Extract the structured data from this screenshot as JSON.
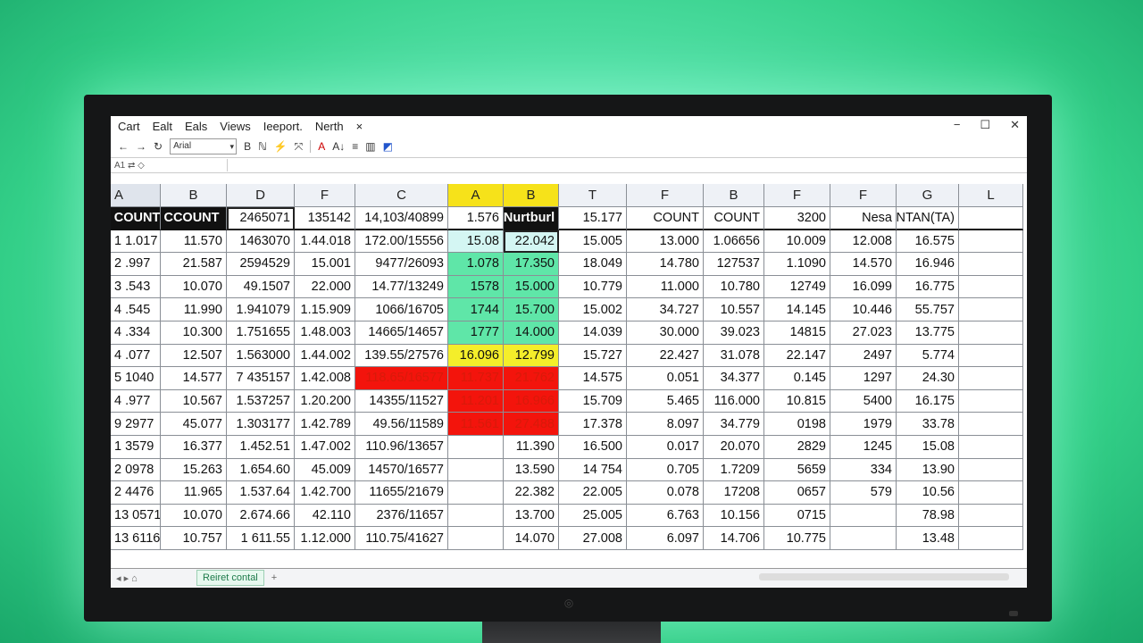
{
  "menu": [
    "Cart",
    "Ealt",
    "Eals",
    "Views",
    "Ieeport.",
    "Nerth",
    "×"
  ],
  "window_controls": [
    "−",
    "☐",
    "✕"
  ],
  "toolbar": {
    "back": "←",
    "forward": "→",
    "refresh": "↻",
    "font": "Arial",
    "bold": "B",
    "icons": [
      "ℕ",
      "⚡",
      "⤧",
      "A",
      "A↓",
      "≡",
      "▥",
      "◩"
    ]
  },
  "formula_bar": {
    "name_box": "A1",
    "nav": "⇄ ◇"
  },
  "column_headers": [
    "A",
    "B",
    "D",
    "F",
    "C",
    "A",
    "B",
    "T",
    "F",
    "B",
    "F",
    "F",
    "G",
    "L"
  ],
  "rows": [
    [
      "COUNT",
      "CCOUNT",
      "2465071",
      "135142",
      "14,103/40899",
      "1.576",
      "Nurtburl",
      "15.177",
      "COUNT",
      "COUNT",
      "3200",
      "Nesa",
      "COUNTAN(TA)",
      ""
    ],
    [
      "1 1.017",
      "11.570",
      "1463070",
      "1.44.018",
      "172.00/15556",
      "15.08",
      "22.042",
      "15.005",
      "13.000",
      "1.06656",
      "10.009",
      "12.008",
      "16.575",
      ""
    ],
    [
      "2 .997",
      "21.587",
      "2594529",
      "15.001",
      "9477/26093",
      "1.078",
      "17.350",
      "18.049",
      "14.780",
      "127537",
      "1.1090",
      "14.570",
      "16.946",
      ""
    ],
    [
      "3 .543",
      "10.070",
      "49.1507",
      "22.000",
      "14.77/13249",
      "1578",
      "15.000",
      "10.779",
      "11.000",
      "10.780",
      "12749",
      "16.099",
      "16.775",
      ""
    ],
    [
      "4 .545",
      "11.990",
      "1.941079",
      "1.15.909",
      "1066/16705",
      "1744",
      "15.700",
      "15.002",
      "34.727",
      "10.557",
      "14.145",
      "10.446",
      "55.757",
      ""
    ],
    [
      "4 .334",
      "10.300",
      "1.751655",
      "1.48.003",
      "14665/14657",
      "1777",
      "14.000",
      "14.039",
      "30.000",
      "39.023",
      "14815",
      "27.023",
      "13.775",
      ""
    ],
    [
      "4 .077",
      "12.507",
      "1.563000",
      "1.44.002",
      "139.55/27576",
      "16.096",
      "12.799",
      "15.727",
      "22.427",
      "31.078",
      "22.147",
      "2497",
      "5.774",
      ""
    ],
    [
      "5 1040",
      "14.577",
      "7 435157",
      "1.42.008",
      "118.65/16577",
      "11.737",
      "21.762",
      "14.575",
      "0.051",
      "34.377",
      "0.145",
      "1297",
      "24.30",
      ""
    ],
    [
      "4 .977",
      "10.567",
      "1.537257",
      "1.20.200",
      "14355/11527",
      "11.201",
      "16.966",
      "15.709",
      "5.465",
      "116.000",
      "10.815",
      "5400",
      "16.175",
      ""
    ],
    [
      "9 2977",
      "45.077",
      "1.303177",
      "1.42.789",
      "49.56/11589",
      "11.561",
      "27.488",
      "17.378",
      "8.097",
      "34.779",
      "0198",
      "1979",
      "33.78",
      ""
    ],
    [
      "1 3579",
      "16.377",
      "1.452.51",
      "1.47.002",
      "110.96/13657",
      "",
      "11.390",
      "16.500",
      "0.017",
      "20.070",
      "2829",
      "1245",
      "15.08",
      ""
    ],
    [
      "2 0978",
      "15.263",
      "1.654.60",
      "45.009",
      "14570/16577",
      "",
      "13.590",
      "14 754",
      "0.705",
      "1.7209",
      "5659",
      "334",
      "13.90",
      ""
    ],
    [
      "2 4476",
      "11.965",
      "1.537.64",
      "1.42.700",
      "11655/21679",
      "",
      "22.382",
      "22.005",
      "0.078",
      "17208",
      "0657",
      "579",
      "10.56",
      ""
    ],
    [
      "13 0571",
      "10.070",
      "2.674.66",
      "42.110",
      "2376/11657",
      "",
      "13.700",
      "25.005",
      "6.763",
      "10.156",
      "0715",
      "",
      "78.98",
      ""
    ],
    [
      "13 6116",
      "10.757",
      "1 611.55",
      "1.12.000",
      "110.75/41627",
      "",
      "14.070",
      "27.008",
      "6.097",
      "14.706",
      "10.775",
      "",
      "13.48",
      ""
    ]
  ],
  "sheet_tabs": {
    "nav": "◂ ▸   ⌂",
    "active": "Reiret contal",
    "add": "+"
  },
  "colors": {
    "highlight_green": "#5fe6a8",
    "highlight_yellow": "#f4ee2a",
    "highlight_red": "#f3140c",
    "header_yellow": "#f6e21a"
  }
}
